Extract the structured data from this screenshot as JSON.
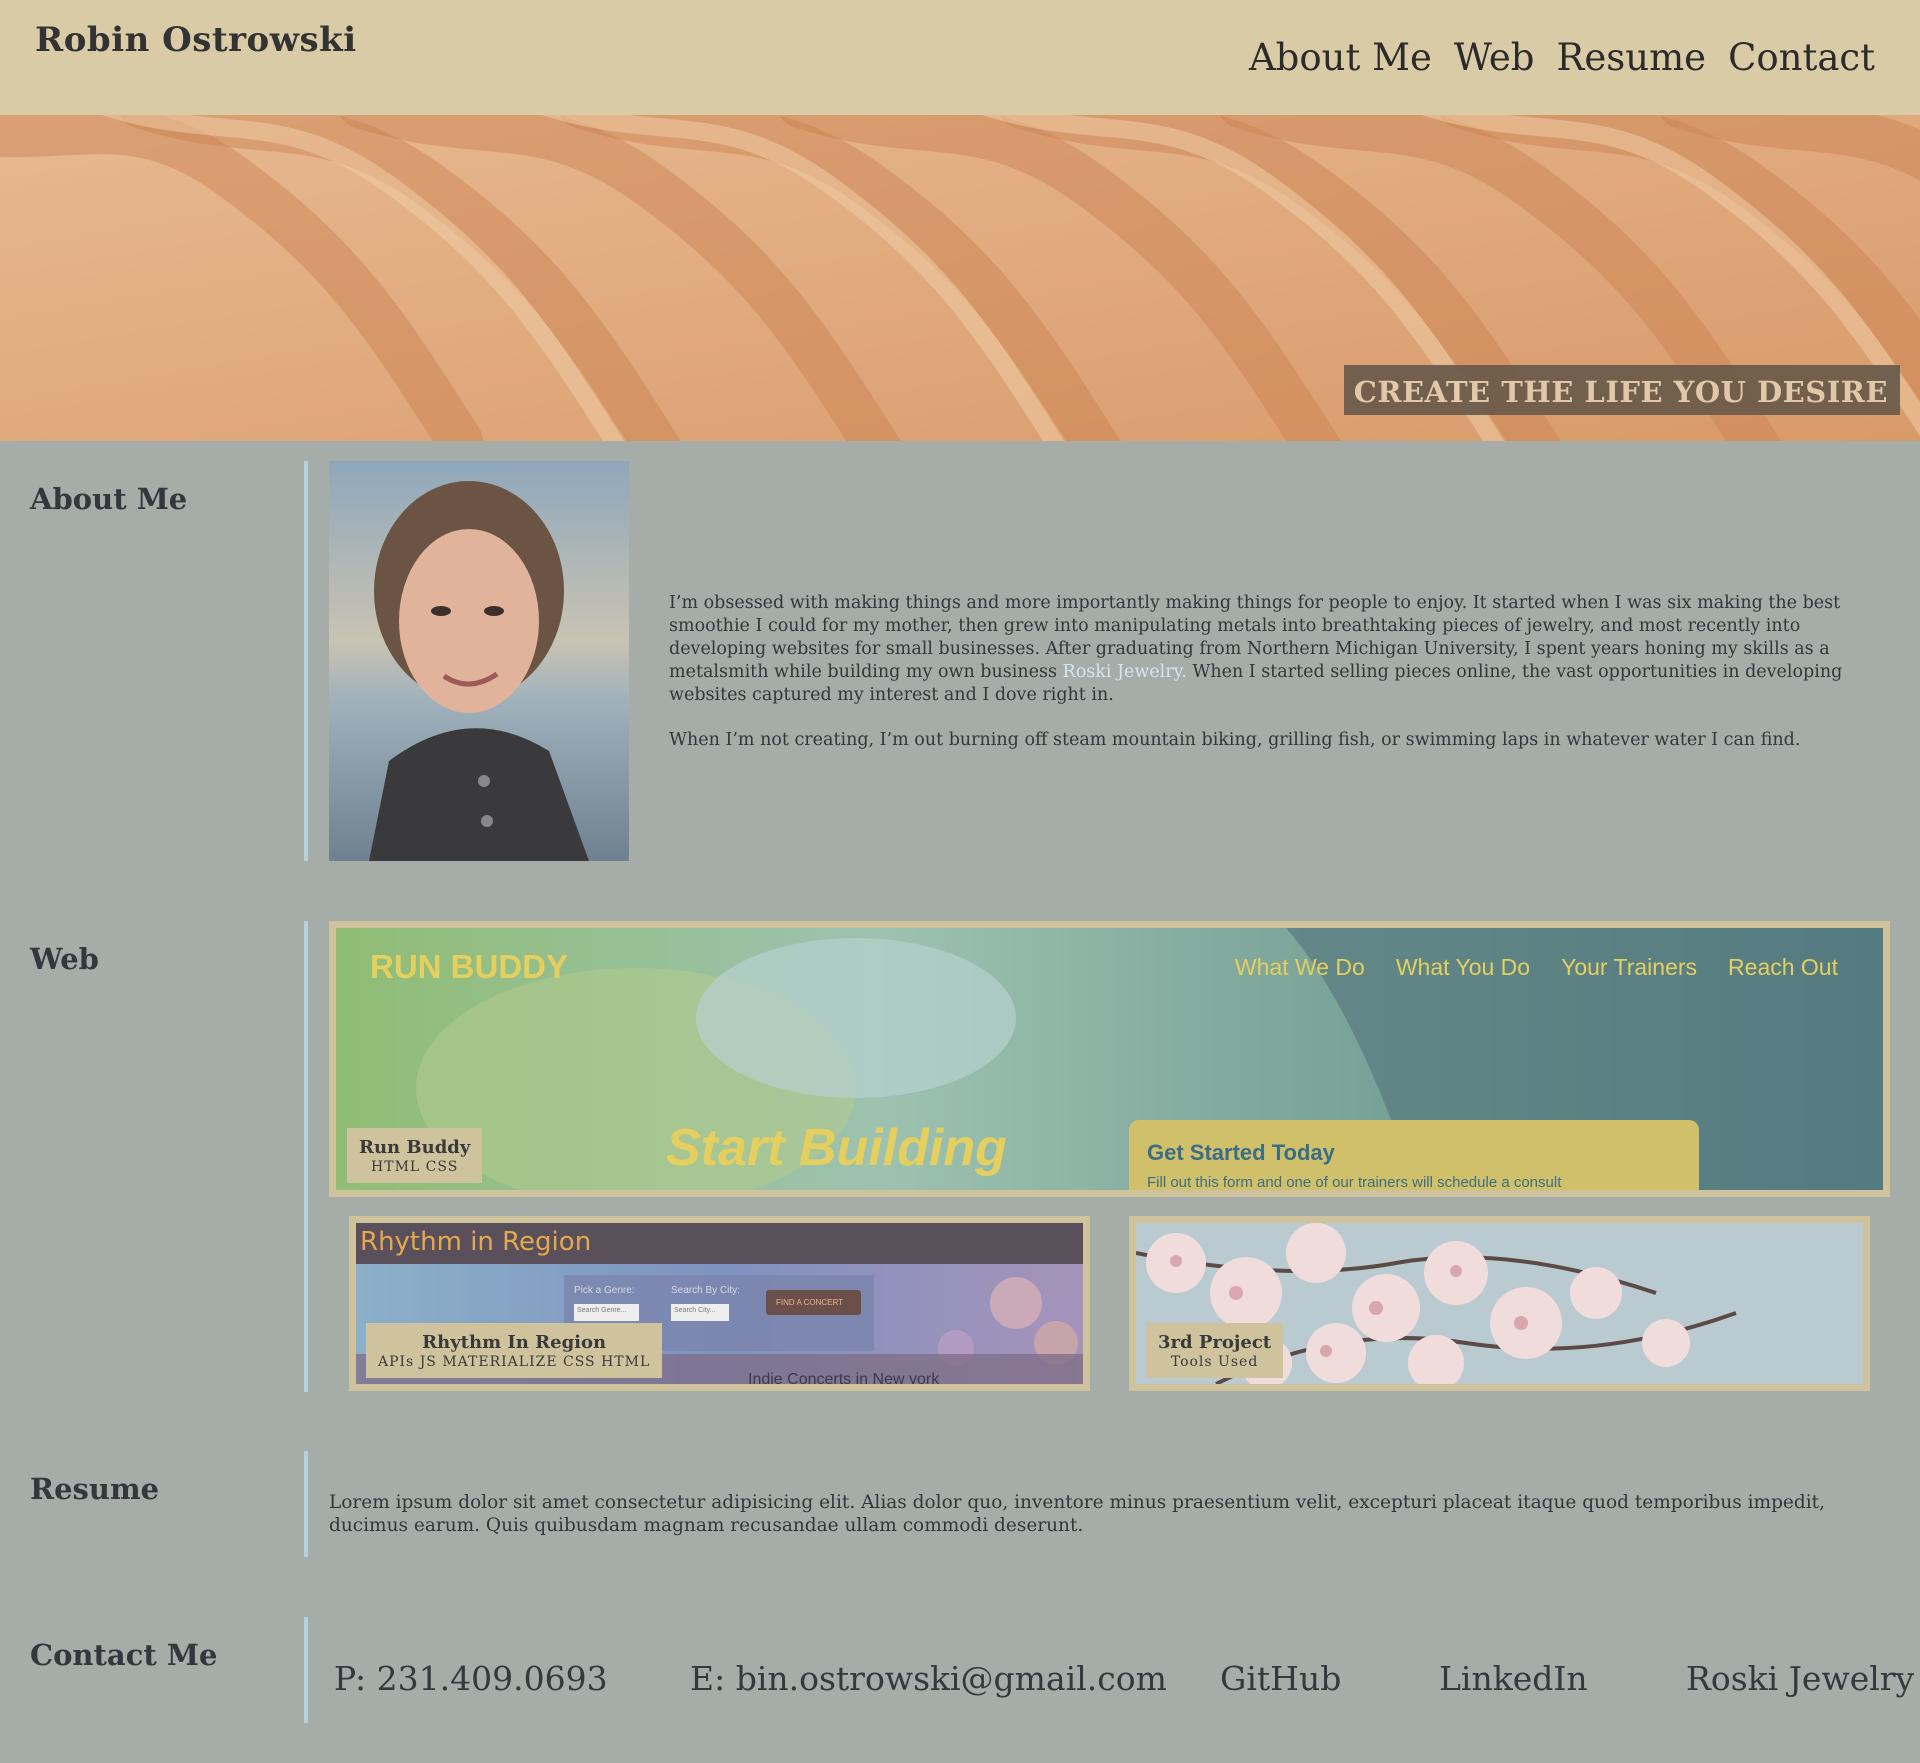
{
  "header": {
    "name": "Robin Ostrowski",
    "nav": [
      {
        "label": "About Me"
      },
      {
        "label": "Web"
      },
      {
        "label": "Resume"
      },
      {
        "label": "Contact"
      }
    ]
  },
  "hero": {
    "tagline": "CREATE THE LIFE YOU DESIRE"
  },
  "about": {
    "title": "About Me",
    "bio_part1": "I’m obsessed with making things and more importantly making things for people to enjoy. It started when I was six making the best smoothie I could for my mother, then grew into manipulating metals into breathtaking pieces of jewelry, and most recently into developing websites for small businesses. After graduating from Northern Michigan University, I spent years honing my skills as a metalsmith while building my own business ",
    "bio_link": "Roski Jewelry.",
    "bio_part2": " When I started selling pieces online, the vast opportunities in developing websites captured my interest and I dove right in.",
    "bio_p2": "When I’m not creating, I’m out burning off steam mountain biking, grilling fish, or swimming laps in whatever water I can find."
  },
  "web": {
    "title": "Web",
    "projects": [
      {
        "name": "Run Buddy",
        "tools": "HTML  CSS",
        "screenshot": {
          "logo": "RUN BUDDY",
          "nav": [
            "What We Do",
            "What You Do",
            "Your Trainers",
            "Reach Out"
          ],
          "headline": "Start Building",
          "card_title": "Get Started Today",
          "card_text": "Fill out this form and one of our trainers will schedule a consult"
        }
      },
      {
        "name": "Rhythm In Region",
        "tools": "APIs  JS  MATERIALIZE  CSS  HTML",
        "screenshot": {
          "title": "Rhythm in Region",
          "genre_label": "Pick a Genre:",
          "genre_placeholder": "Search Genre...",
          "city_label": "Search By City:",
          "city_placeholder": "Search City...",
          "button": "FIND A CONCERT",
          "footer_text": "Indie Concerts in New york"
        }
      },
      {
        "name": "3rd Project",
        "tools": "Tools  Used"
      }
    ]
  },
  "resume": {
    "title": "Resume",
    "text": "Lorem ipsum dolor sit amet consectetur adipisicing elit. Alias dolor quo, inventore minus praesentium velit, excepturi placeat itaque quod temporibus impedit, ducimus earum. Quis quibusdam magnam recusandae ullam commodi deserunt."
  },
  "contact": {
    "title": "Contact Me",
    "phone": "P: 231.409.0693",
    "email": "E: bin.ostrowski@gmail.com",
    "github": "GitHub",
    "linkedin": "LinkedIn",
    "business": "Roski Jewelry"
  },
  "colors": {
    "header_bg": "#d8cba5",
    "page_bg": "#a6aca8",
    "accent_bar": "#b6d1dc",
    "frame": "#cfc39e",
    "link": "#d3e6ef"
  }
}
